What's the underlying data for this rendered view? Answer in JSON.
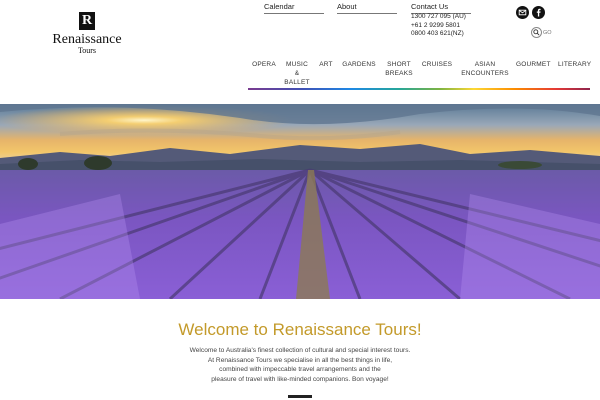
{
  "brand": {
    "name": "Renaissance",
    "sub": "Tours",
    "mark": "R"
  },
  "top_links": {
    "calendar": "Calendar",
    "about": "About",
    "contact": "Contact Us"
  },
  "phones": [
    "1300 727 095 (AU)",
    "+61 2 9299 5801",
    "0800 403 621(NZ)"
  ],
  "icons": {
    "mail": "mail-icon",
    "facebook": "facebook-icon",
    "search": "search-icon"
  },
  "search": {
    "placeholder": "GO"
  },
  "nav": [
    {
      "label": "OPERA"
    },
    {
      "label": "MUSIC & BALLET"
    },
    {
      "label": "ART"
    },
    {
      "label": "GARDENS"
    },
    {
      "label": "SHORT BREAKS"
    },
    {
      "label": "CRUISES"
    },
    {
      "label": "ASIAN ENCOUNTERS"
    },
    {
      "label": "GOURMET"
    },
    {
      "label": "LITERARY"
    }
  ],
  "colors": {
    "accent_gold": "#c39a2a",
    "lavender": "#7b4fc4"
  },
  "welcome": {
    "title": "Welcome to Renaissance Tours!",
    "lines": [
      "Welcome to Australia's finest collection of cultural and special interest tours.",
      "At Renaissance Tours we specialise in all the best things in life,",
      "combined with impeccable travel arrangements and the",
      "pleasure of travel with like-minded companions. Bon voyage!"
    ]
  }
}
